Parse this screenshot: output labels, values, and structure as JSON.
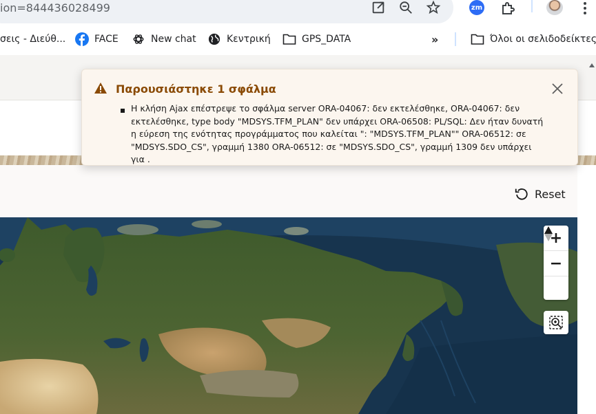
{
  "browser": {
    "url_fragment": "ion=844436028499",
    "zoom_ext_label": "zm",
    "bookmarks": [
      {
        "label": "σεις - Διεύθ...",
        "icon": "none"
      },
      {
        "label": "FACE",
        "icon": "facebook-icon"
      },
      {
        "label": "New chat",
        "icon": "openai-icon"
      },
      {
        "label": "Κεντρική",
        "icon": "globe-icon"
      },
      {
        "label": "GPS_DATA",
        "icon": "folder-icon"
      }
    ],
    "overflow_label": "»",
    "all_bookmarks_label": "Όλοι οι σελιδοδείκτες"
  },
  "alert": {
    "title": "Παρουσιάστηκε 1 σφάλμα",
    "message": "Η κλήση Ajax επέστρεψε το σφάλμα server ORA-04067: δεν εκτελέσθηκε, ORA-04067: δεν εκτελέσθηκε, type body \"MDSYS.TFM_PLAN\" δεν υπάρχει ORA-06508: PL/SQL: Δεν ήταν δυνατή η εύρεση της ενότητας προγράμματος που καλείται \": \"MDSYS.TFM_PLAN\"\" ORA-06512: σε \"MDSYS.SDO_CS\", γραμμή 1380 ORA-06512: σε \"MDSYS.SDO_CS\", γραμμή 1309 δεν υπάρχει για .",
    "accent_color": "#8a4a05"
  },
  "reset": {
    "label": "Reset"
  },
  "map": {
    "zoom_in_label": "+",
    "zoom_out_label": "−"
  }
}
